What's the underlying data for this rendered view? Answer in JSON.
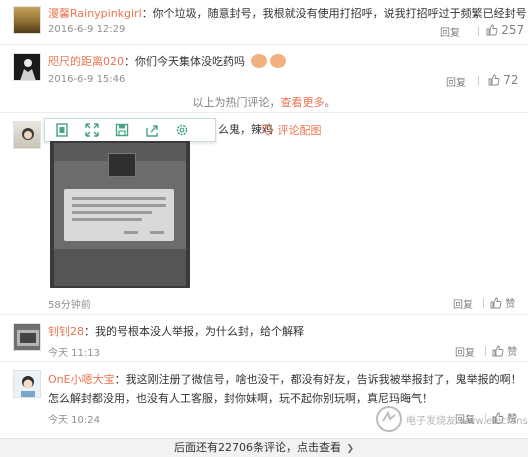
{
  "comments": [
    {
      "name": "漫馨Rainypinkgirl",
      "text": "：你个垃圾，随意封号，我根就没有使用打招呼，说我打招呼过于频繁已经封号",
      "time": "2016-6-9 12:29",
      "reply": "回复",
      "likes": "257"
    },
    {
      "name": "咫尺的距离020",
      "text": "：你们今天集体没吃药吗",
      "time": "2016-6-9 15:46",
      "reply": "回复",
      "likes": "72"
    },
    {
      "text_fragment": "么鬼，辣鸡",
      "tool_label": "评论配图",
      "time": "58分钟前",
      "reply": "回复",
      "likes": "赞"
    },
    {
      "name": "钊钊28",
      "text": "：我的号根本没人举报，为什么封，给个解释",
      "time": "今天 11:13",
      "reply": "回复",
      "likes": "赞"
    },
    {
      "name": "OnE小嗯大宝",
      "text": "：我这刚注册了微信号，啥也没干，都没有好友，告诉我被举报封了，鬼举报的啊！",
      "text2": "怎么解封都没用，也没有人工客服，封你妹啊，玩不起你别玩啊，真尼玛晦气！",
      "time": "今天 10:24",
      "reply": "回复",
      "likes": "赞"
    }
  ],
  "hot_notice": {
    "prefix": "以上为热门评论，",
    "link": "查看更多",
    "suffix": "。"
  },
  "footer": {
    "text": "后面还有22706条评论，点击查看",
    "arrow": "❯"
  },
  "watermark": "电子发烧友 www.elecfans.com",
  "colors": {
    "name": "#eb7350",
    "link": "#eb7350",
    "toolbar_icon": "#4aa386"
  },
  "icons": [
    "thumb-up-icon",
    "fit-icon",
    "expand-icon",
    "save-icon",
    "share-icon",
    "settings-icon",
    "tag-icon"
  ]
}
